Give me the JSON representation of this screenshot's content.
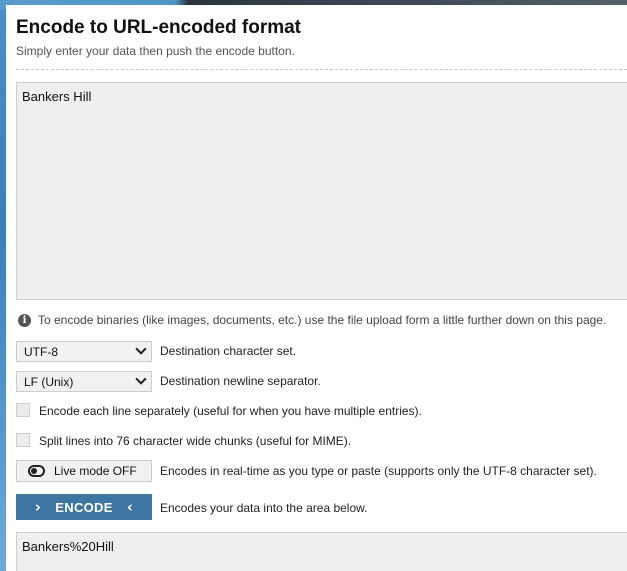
{
  "page": {
    "title": "Encode to URL-encoded format",
    "subtitle": "Simply enter your data then push the encode button."
  },
  "input": {
    "value": "Bankers Hill"
  },
  "info": {
    "icon": "info-icon",
    "text": "To encode binaries (like images, documents, etc.) use the file upload form a little further down on this page."
  },
  "charset": {
    "selected": "UTF-8",
    "label": "Destination character set."
  },
  "newline": {
    "selected": "LF (Unix)",
    "label": "Destination newline separator."
  },
  "options": {
    "each_line": "Encode each line separately (useful for when you have multiple entries).",
    "split_lines": "Split lines into 76 character wide chunks (useful for MIME)."
  },
  "live": {
    "button_label": "Live mode OFF",
    "description": "Encodes in real-time as you type or paste (supports only the UTF-8 character set)."
  },
  "encode": {
    "button_label": "ENCODE",
    "description": "Encodes your data into the area below."
  },
  "output": {
    "value": "Bankers%20Hill"
  },
  "colors": {
    "accent": "#3d76a3",
    "field_bg": "#efefef"
  }
}
